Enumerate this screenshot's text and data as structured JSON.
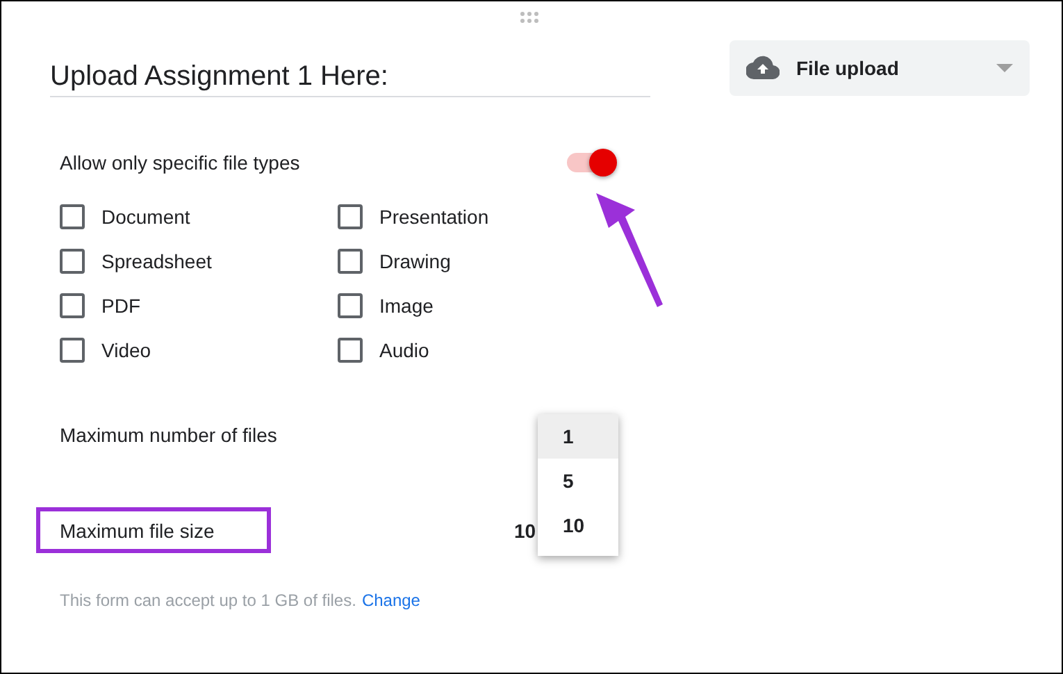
{
  "title": "Upload Assignment 1 Here:",
  "question_type": {
    "label": "File upload"
  },
  "file_types": {
    "label": "Allow only specific file types",
    "on": true,
    "options": [
      {
        "label": "Document",
        "checked": false
      },
      {
        "label": "Presentation",
        "checked": false
      },
      {
        "label": "Spreadsheet",
        "checked": false
      },
      {
        "label": "Drawing",
        "checked": false
      },
      {
        "label": "PDF",
        "checked": false
      },
      {
        "label": "Image",
        "checked": false
      },
      {
        "label": "Video",
        "checked": false
      },
      {
        "label": "Audio",
        "checked": false
      }
    ]
  },
  "max_files": {
    "label": "Maximum number of files",
    "menu": [
      {
        "label": "1",
        "selected": true
      },
      {
        "label": "5",
        "selected": false
      },
      {
        "label": "10",
        "selected": false
      }
    ]
  },
  "max_size": {
    "label": "Maximum file size",
    "value": "10",
    "highlighted": true
  },
  "footer": {
    "text": "This form can accept up to 1 GB of files.",
    "link": "Change"
  }
}
